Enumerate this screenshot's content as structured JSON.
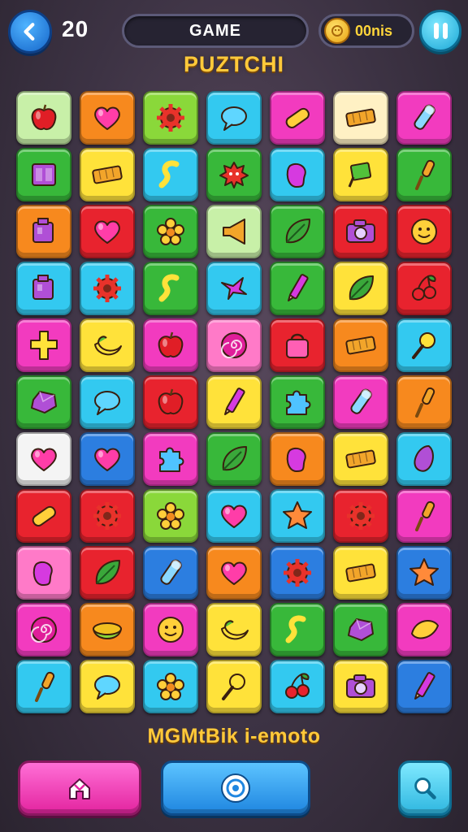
{
  "header": {
    "level": "20",
    "title": "GAME",
    "coins": "00nis",
    "back_icon": "chevron-left-icon",
    "pause_icon": "pause-icon"
  },
  "subtitle": "PUZTCHI",
  "caption": "MGMtBik i-emoto",
  "colors": {
    "red": "#e8232e",
    "orange": "#f7891e",
    "lime": "#8ad83a",
    "cyan": "#33c9f0",
    "magenta": "#f23bbf",
    "yellow": "#ffe23a",
    "green": "#38b83a",
    "blue": "#2c7ee0",
    "pink": "#ff7ac8",
    "cream": "#fff1c4",
    "lightgreen": "#c8f0a8",
    "white": "#f4f4f4"
  },
  "board": {
    "rows": [
      [
        {
          "color": "lightgreen",
          "icon": "apple"
        },
        {
          "color": "orange",
          "icon": "heart"
        },
        {
          "color": "lime",
          "icon": "gear"
        },
        {
          "color": "cyan",
          "icon": "bubble"
        },
        {
          "color": "magenta",
          "icon": "capsule"
        },
        {
          "color": "cream",
          "icon": "bar"
        },
        {
          "color": "magenta",
          "icon": "tube"
        }
      ],
      [
        {
          "color": "green",
          "icon": "box"
        },
        {
          "color": "yellow",
          "icon": "bar"
        },
        {
          "color": "cyan",
          "icon": "hook"
        },
        {
          "color": "green",
          "icon": "spiky"
        },
        {
          "color": "cyan",
          "icon": "bean"
        },
        {
          "color": "yellow",
          "icon": "flag"
        },
        {
          "color": "green",
          "icon": "brush"
        }
      ],
      [
        {
          "color": "orange",
          "icon": "cube"
        },
        {
          "color": "red",
          "icon": "heart"
        },
        {
          "color": "green",
          "icon": "flower"
        },
        {
          "color": "lightgreen",
          "icon": "horn"
        },
        {
          "color": "green",
          "icon": "leaf"
        },
        {
          "color": "red",
          "icon": "camera"
        },
        {
          "color": "red",
          "icon": "face"
        }
      ],
      [
        {
          "color": "cyan",
          "icon": "cube"
        },
        {
          "color": "cyan",
          "icon": "gear"
        },
        {
          "color": "green",
          "icon": "hook"
        },
        {
          "color": "cyan",
          "icon": "bird"
        },
        {
          "color": "green",
          "icon": "pencil"
        },
        {
          "color": "yellow",
          "icon": "leaf"
        },
        {
          "color": "red",
          "icon": "cherries"
        }
      ],
      [
        {
          "color": "magenta",
          "icon": "cross"
        },
        {
          "color": "yellow",
          "icon": "banana"
        },
        {
          "color": "magenta",
          "icon": "apple"
        },
        {
          "color": "pink",
          "icon": "spiral"
        },
        {
          "color": "red",
          "icon": "bag"
        },
        {
          "color": "orange",
          "icon": "bar"
        },
        {
          "color": "cyan",
          "icon": "lollipop"
        }
      ],
      [
        {
          "color": "green",
          "icon": "gem"
        },
        {
          "color": "cyan",
          "icon": "bubble"
        },
        {
          "color": "red",
          "icon": "apple"
        },
        {
          "color": "yellow",
          "icon": "pencil"
        },
        {
          "color": "green",
          "icon": "puzzle"
        },
        {
          "color": "magenta",
          "icon": "tube"
        },
        {
          "color": "orange",
          "icon": "brush"
        }
      ],
      [
        {
          "color": "white",
          "icon": "heart"
        },
        {
          "color": "blue",
          "icon": "heart"
        },
        {
          "color": "magenta",
          "icon": "puzzle"
        },
        {
          "color": "green",
          "icon": "leaf"
        },
        {
          "color": "orange",
          "icon": "bean"
        },
        {
          "color": "yellow",
          "icon": "bar"
        },
        {
          "color": "cyan",
          "icon": "egg"
        }
      ],
      [
        {
          "color": "red",
          "icon": "capsule"
        },
        {
          "color": "red",
          "icon": "gear"
        },
        {
          "color": "lime",
          "icon": "flower"
        },
        {
          "color": "cyan",
          "icon": "heart"
        },
        {
          "color": "cyan",
          "icon": "star"
        },
        {
          "color": "red",
          "icon": "gear"
        },
        {
          "color": "magenta",
          "icon": "brush"
        }
      ],
      [
        {
          "color": "pink",
          "icon": "bean"
        },
        {
          "color": "red",
          "icon": "leaf"
        },
        {
          "color": "blue",
          "icon": "tube"
        },
        {
          "color": "orange",
          "icon": "heart"
        },
        {
          "color": "blue",
          "icon": "gear"
        },
        {
          "color": "yellow",
          "icon": "bar"
        },
        {
          "color": "blue",
          "icon": "star"
        }
      ],
      [
        {
          "color": "magenta",
          "icon": "spiral"
        },
        {
          "color": "orange",
          "icon": "melon"
        },
        {
          "color": "magenta",
          "icon": "face"
        },
        {
          "color": "yellow",
          "icon": "banana"
        },
        {
          "color": "green",
          "icon": "hook"
        },
        {
          "color": "green",
          "icon": "gem"
        },
        {
          "color": "magenta",
          "icon": "lemon"
        }
      ],
      [
        {
          "color": "cyan",
          "icon": "brush"
        },
        {
          "color": "yellow",
          "icon": "bubble"
        },
        {
          "color": "cyan",
          "icon": "flower"
        },
        {
          "color": "yellow",
          "icon": "lollipop"
        },
        {
          "color": "cyan",
          "icon": "cherries"
        },
        {
          "color": "yellow",
          "icon": "camera"
        },
        {
          "color": "blue",
          "icon": "pencil"
        }
      ]
    ]
  },
  "icon_colors": {
    "apple": "#e01e26",
    "heart": "#ff3da8",
    "gear": "#e8322a",
    "bubble": "#5fd6ff",
    "capsule": "#ffcf3a",
    "bar": "#f2a52a",
    "tube": "#8ad8ff",
    "box": "#b04fd6",
    "hook": "#ffe23a",
    "spiky": "#e8322a",
    "bean": "#d63ae0",
    "flag": "#52c23a",
    "brush": "#f2a52a",
    "cube": "#b04fd6",
    "flower": "#ffcf3a",
    "horn": "#f2a52a",
    "leaf": "#3aa83a",
    "camera": "#b04fd6",
    "face": "#ffcf3a",
    "bird": "#d63ae0",
    "pencil": "#d63ae0",
    "cherries": "#3aa83a",
    "cross": "#ffe23a",
    "banana": "#ffe23a",
    "spiral": "#e01e9a",
    "bag": "#ff5fb4",
    "lollipop": "#ffe23a",
    "gem": "#b04fd6",
    "puzzle": "#4fc3ff",
    "egg": "#b04fd6",
    "star": "#ff8a3a",
    "melon": "#8ad83a",
    "lemon": "#ffcf3a"
  },
  "buttons": {
    "left_icon": "home-icon",
    "mid_icon": "target-icon",
    "right_icon": "search-icon"
  }
}
